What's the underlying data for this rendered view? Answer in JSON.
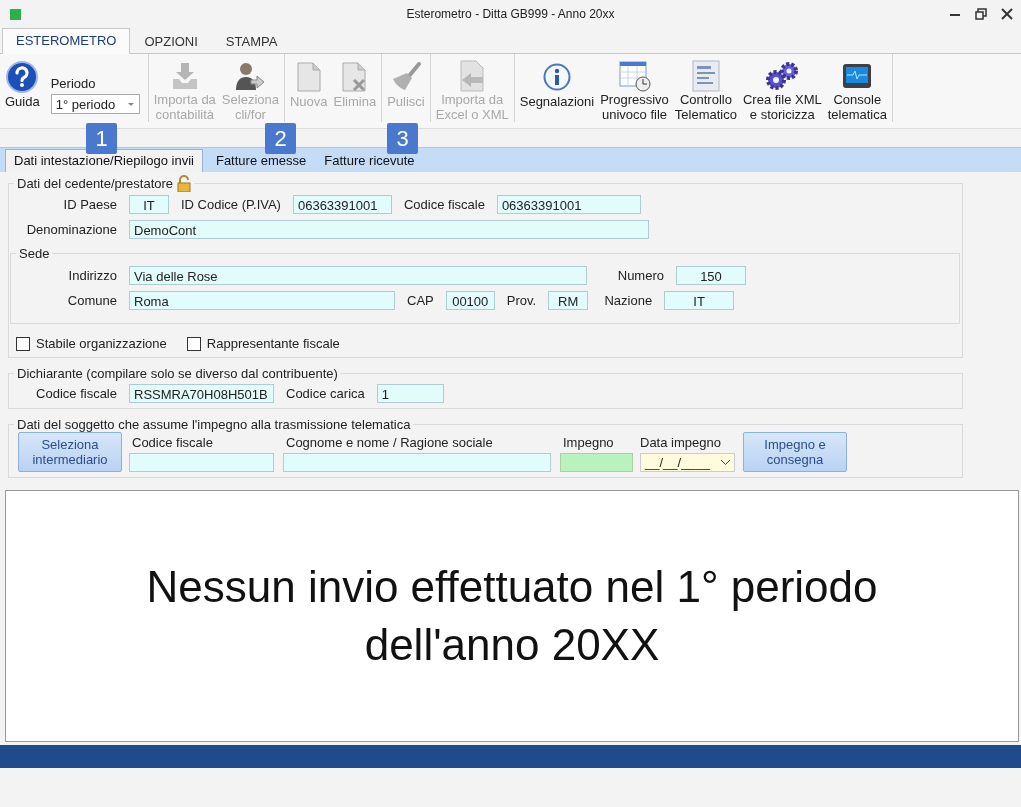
{
  "window": {
    "title": "Esterometro - Ditta GB999 - Anno 20xx"
  },
  "ribbon_tabs": [
    {
      "label": "ESTEROMETRO",
      "selected": true
    },
    {
      "label": "OPZIONI",
      "selected": false
    },
    {
      "label": "STAMPA",
      "selected": false
    }
  ],
  "ribbon_groups": [
    {
      "items": [
        {
          "kind": "button",
          "label": "Guida",
          "disabled": false
        },
        {
          "kind": "dropdown",
          "label": "Periodo",
          "value": "1° periodo"
        }
      ]
    },
    {
      "items": [
        {
          "kind": "button",
          "label": "Importa da\ncontabilità",
          "disabled": true
        },
        {
          "kind": "button",
          "label": "Seleziona\ncli/for",
          "disabled": true
        }
      ]
    },
    {
      "items": [
        {
          "kind": "button",
          "label": "Nuova",
          "disabled": true
        },
        {
          "kind": "button",
          "label": "Elimina",
          "disabled": true
        }
      ]
    },
    {
      "items": [
        {
          "kind": "button",
          "label": "Pulisci",
          "disabled": true
        }
      ]
    },
    {
      "items": [
        {
          "kind": "button",
          "label": "Importa da\nExcel o XML",
          "disabled": true
        }
      ]
    },
    {
      "items": [
        {
          "kind": "button",
          "label": "Segnalazioni",
          "disabled": false
        },
        {
          "kind": "button",
          "label": "Progressivo\nunivoco file",
          "disabled": false
        },
        {
          "kind": "button",
          "label": "Controllo\nTelematico",
          "disabled": false
        },
        {
          "kind": "button",
          "label": "Crea file XML\ne storicizza",
          "disabled": false
        },
        {
          "kind": "button",
          "label": "Console\ntelematica",
          "disabled": false
        }
      ]
    }
  ],
  "callouts": [
    "1",
    "2",
    "3"
  ],
  "form_tabs": [
    {
      "label": "Dati intestazione/Riepilogo invii",
      "selected": true
    },
    {
      "label": "Fatture emesse",
      "selected": false
    },
    {
      "label": "Fatture ricevute",
      "selected": false
    }
  ],
  "cedente": {
    "title": "Dati del cedente/prestatore",
    "id_paese": {
      "label": "ID Paese",
      "value": "IT"
    },
    "id_codice": {
      "label": "ID Codice (P.IVA)",
      "value": "06363391001"
    },
    "codice_fiscale": {
      "label": "Codice fiscale",
      "value": "06363391001"
    },
    "denominazione": {
      "label": "Denominazione",
      "value": "DemoCont"
    },
    "sede": {
      "title": "Sede",
      "indirizzo": {
        "label": "Indirizzo",
        "value": "Via delle Rose"
      },
      "numero": {
        "label": "Numero",
        "value": "150"
      },
      "comune": {
        "label": "Comune",
        "value": "Roma"
      },
      "cap": {
        "label": "CAP",
        "value": "00100"
      },
      "prov": {
        "label": "Prov.",
        "value": "RM"
      },
      "nazione": {
        "label": "Nazione",
        "value": "IT"
      }
    },
    "checkboxes": [
      {
        "label": "Stabile organizzazione",
        "checked": false
      },
      {
        "label": "Rappresentante fiscale",
        "checked": false
      }
    ]
  },
  "dichiarante": {
    "title": "Dichiarante (compilare solo se diverso dal contribuente)",
    "codice_fiscale": {
      "label": "Codice fiscale",
      "value": "RSSMRA70H08H501B"
    },
    "codice_carica": {
      "label": "Codice carica",
      "value": "1"
    }
  },
  "impegno": {
    "title": "Dati del soggetto che assume l'impegno alla trasmissione telematica",
    "select_button": "Seleziona\nintermediario",
    "codice_fiscale": {
      "label": "Codice fiscale"
    },
    "nominativo": {
      "label": "Cognome e nome / Ragione sociale"
    },
    "impegno": {
      "label": "Impegno"
    },
    "data_impegno": {
      "label": "Data impegno",
      "value": "__/__/____"
    },
    "submit_button": "Impegno e\nconsegna"
  },
  "message": "Nessun invio effettuato nel 1° periodo\ndell'anno 20XX"
}
